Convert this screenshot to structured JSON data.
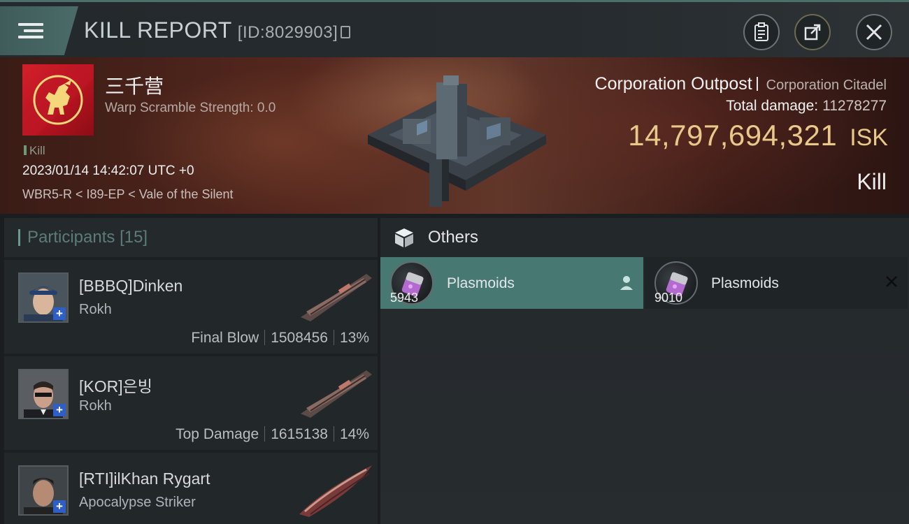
{
  "header": {
    "title": "KILL REPORT",
    "id_label": "[ID:8029903]",
    "buttons": [
      "clipboard",
      "share",
      "close"
    ]
  },
  "victim": {
    "name": "三千营",
    "warp_scramble": "Warp Scramble Strength: 0.0",
    "kill_tag": "Kill",
    "datetime": "2023/01/14 14:42:07 UTC +0",
    "location": "WBR5-R < I89-EP < Vale of the Silent",
    "ship_name": "Corporation Outpost",
    "ship_class": "Corporation Citadel",
    "total_damage_label": "Total damage:",
    "total_damage_value": "11278277",
    "isk_value": "14,797,694,321",
    "isk_unit": "ISK",
    "kill_type": "Kill"
  },
  "participants": {
    "label": "Participants",
    "count": "[15]",
    "items": [
      {
        "name": "[BBBQ]Dinken",
        "ship": "Rokh",
        "role": "Final Blow",
        "damage": "1508456",
        "percent": "13%"
      },
      {
        "name": "[KOR]은빙",
        "ship": "Rokh",
        "role": "Top Damage",
        "damage": "1615138",
        "percent": "14%"
      },
      {
        "name": "[RTI]ilKhan Rygart",
        "ship": "Apocalypse Striker",
        "role": "",
        "damage": "",
        "percent": ""
      }
    ]
  },
  "others": {
    "label": "Others",
    "items": [
      {
        "name": "Plasmoids",
        "qty": "5943",
        "selected": true
      },
      {
        "name": "Plasmoids",
        "qty": "9010",
        "selected": false
      }
    ]
  },
  "colors": {
    "accent_teal": "#477872",
    "isk_gold": "#e8c98a",
    "corp_red": "#d41f2b"
  }
}
